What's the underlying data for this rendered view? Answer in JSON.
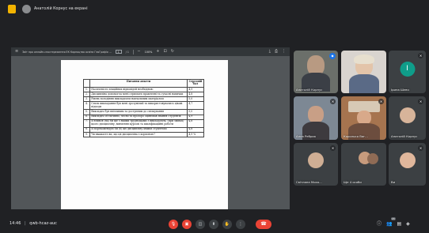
{
  "presenter": {
    "label": "Анатолій Корнус на екрані"
  },
  "viewer": {
    "title": "Звіт про онлайн-спостереження ЕК Корнацтво освіти ГеоГрафія ...",
    "page_input": "1",
    "page_total": "/ 1",
    "zoom": "100%"
  },
  "table": {
    "headers": [
      "",
      "Питання анкети",
      "Середній бал"
    ],
    "rows": [
      {
        "num": "1.",
        "text": "Насиченість лекційних відповідей необхідною",
        "value": "4,9"
      },
      {
        "num": "2.",
        "text": "Дисципліна допомогла мені отримати практичні та сучасні навички",
        "value": "4,8"
      },
      {
        "num": "3.",
        "text": "Рівень володіння викладачем навчальним матеріалом",
        "value": "5,0"
      },
      {
        "num": "4.",
        "text": "Стиль викладання був мені зрозумілий та використовувались цікаві підходи",
        "value": "4,7"
      },
      {
        "num": "5.",
        "text": "Викладач був ввічливим та доступним до спілкування",
        "value": "5,0"
      },
      {
        "num": "6.",
        "text": "Викладач об'єктивно, чесно та прозоро оцінював знання студентів",
        "value": "4,9"
      },
      {
        "num": "7.",
        "text": "Я вчився (на) би ще з якими труднощами з викладачем, (при змінах) цього дисципліну, вивчення курсові та кваліфікаційні роботи",
        "value": "4,8"
      },
      {
        "num": "8.",
        "text": "Я порекомендую би (б) цю дисципліну іншим студентам",
        "value": "4,8"
      },
      {
        "num": "9.",
        "text": "Чи вважаєте ви, що ця дисципліна є корисною?",
        "value": "4,9 %"
      }
    ]
  },
  "participants": [
    {
      "name": "Анатолій Корнус",
      "pinned": true
    },
    {
      "name": ""
    },
    {
      "name": "Ірина Шевч",
      "initial": "I"
    },
    {
      "name": "Алла Ребрик"
    },
    {
      "name": "Королько Ваг..."
    },
    {
      "name": "Анатолій Корнус"
    },
    {
      "name": "Світлана Мохо..."
    },
    {
      "name": "Ще 4 особи"
    },
    {
      "name": "Ви"
    }
  ],
  "bottom": {
    "time": "14:46",
    "meeting_code": "qwb-hcaz-auc",
    "people_badge": "18"
  },
  "icons": {
    "mic": "mic-off-icon",
    "camera": "camera-off-icon",
    "captions": "captions-icon",
    "present": "present-icon",
    "raise_hand": "raise-hand-icon",
    "more": "more-icon",
    "hangup": "phone-icon",
    "info": "info-icon",
    "people": "people-icon",
    "chat": "chat-icon",
    "activities": "activities-icon"
  },
  "colors": {
    "background": "#202124",
    "accent": "#1a73e8",
    "danger": "#ea4335",
    "tile": "#3c4043"
  }
}
